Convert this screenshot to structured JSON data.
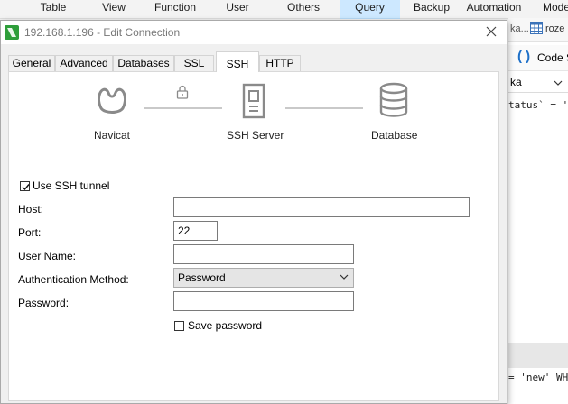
{
  "menubar": {
    "items": [
      {
        "label": "Table"
      },
      {
        "label": "View"
      },
      {
        "label": "Function"
      },
      {
        "label": "User"
      },
      {
        "label": "Others"
      },
      {
        "label": "Query",
        "active": true
      },
      {
        "label": "Backup"
      },
      {
        "label": "Automation"
      },
      {
        "label": "Mode"
      }
    ]
  },
  "background": {
    "tab_fragment": "ka...",
    "tab_label": "roze",
    "toolbar_label": "Code S",
    "select_fragment": "ka",
    "code_line_1": "tatus` = '",
    "code_line_2": "= 'new' WH"
  },
  "dialog": {
    "title": "192.168.1.196 - Edit Connection",
    "tabs": [
      "General",
      "Advanced",
      "Databases",
      "SSL",
      "SSH",
      "HTTP"
    ],
    "selected_tab": "SSH",
    "diagram": {
      "navicat_label": "Navicat",
      "ssh_server_label": "SSH Server",
      "database_label": "Database"
    },
    "use_ssh_tunnel": {
      "label": "Use SSH tunnel",
      "checked": true
    },
    "fields": {
      "host": {
        "label": "Host:",
        "value": ""
      },
      "port": {
        "label": "Port:",
        "value": "22"
      },
      "user_name": {
        "label": "User Name:",
        "value": ""
      },
      "auth_method": {
        "label": "Authentication Method:",
        "value": "Password"
      },
      "password": {
        "label": "Password:",
        "value": ""
      }
    },
    "save_password": {
      "label": "Save password",
      "checked": false
    }
  },
  "colors": {
    "accent": "#cde8ff",
    "navicat_green": "#2e9e3a",
    "icon_gray": "#8a8a8a"
  }
}
